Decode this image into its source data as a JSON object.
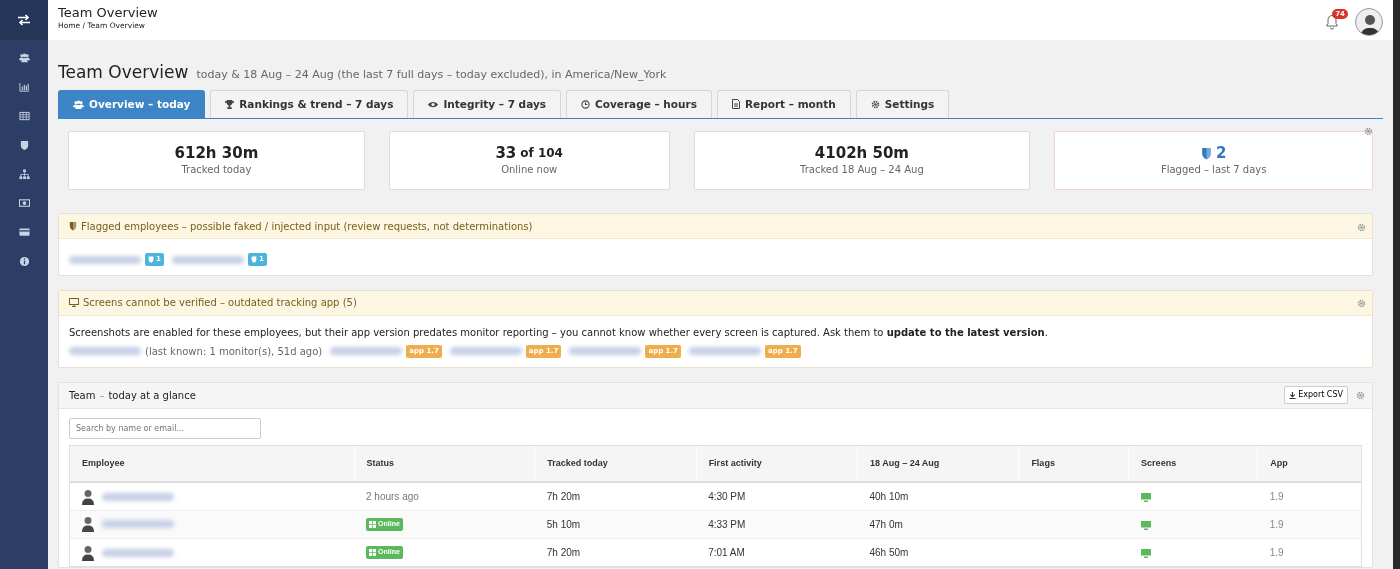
{
  "header": {
    "title": "Team Overview",
    "breadcrumb": "Home / Team Overview",
    "notifications": "74"
  },
  "page": {
    "title": "Team Overview",
    "subtitle": "today & 18 Aug – 24 Aug (the last 7 full days – today excluded), in America/New_York"
  },
  "tabs": [
    {
      "label": "Overview – today",
      "selected": true
    },
    {
      "label": "Rankings & trend – 7 days",
      "selected": false
    },
    {
      "label": "Integrity – 7 days",
      "selected": false
    },
    {
      "label": "Coverage – hours",
      "selected": false
    },
    {
      "label": "Report – month",
      "selected": false
    },
    {
      "label": "Settings",
      "selected": false
    }
  ],
  "stats": [
    {
      "value": "612h 30m",
      "label": "Tracked today",
      "kind": "plain"
    },
    {
      "value": "33",
      "suffix": "of 104",
      "label": "Online now",
      "kind": "plain"
    },
    {
      "value": "4102h 50m",
      "label": "Tracked 18 Aug – 24 Aug",
      "kind": "plain"
    },
    {
      "value": "2",
      "label": "Flagged – last 7 days",
      "kind": "flag"
    }
  ],
  "flagged_panel": {
    "title": "Flagged employees – possible faked / injected input (review requests, not determinations)",
    "employees": [
      {
        "badge": "1"
      },
      {
        "badge": "1"
      }
    ]
  },
  "screens_panel": {
    "title": "Screens cannot be verified – outdated tracking app (5)",
    "message": "Screenshots are enabled for these employees, but their app version predates monitor reporting – you cannot know whether every screen is captured. Ask them to **update to the latest version**.",
    "employees": [
      {
        "kind": "note",
        "text": "(last known: 1 monitor(s), 51d ago)"
      },
      {
        "kind": "badge",
        "text": "app 1.7"
      },
      {
        "kind": "badge",
        "text": "app 1.7"
      },
      {
        "kind": "badge",
        "text": "app 1.7"
      },
      {
        "kind": "badge",
        "text": "app 1.7"
      }
    ]
  },
  "team_panel": {
    "title": "Team",
    "separator": "–",
    "subtitle": "today at a glance",
    "export_button": "Export CSV",
    "search": {
      "placeholder": "Search by name or email..."
    },
    "columns": [
      "Employee",
      "Status",
      "Tracked today",
      "First activity",
      "18 Aug – 24 Aug",
      "Flags",
      "Screens",
      "App"
    ],
    "rows": [
      {
        "status": {
          "kind": "text",
          "text": "2 hours ago"
        },
        "tracked": "7h 20m",
        "first": "4:30 PM",
        "week": "40h 10m",
        "screens": true,
        "app": "1.9"
      },
      {
        "status": {
          "kind": "online",
          "text": "Online"
        },
        "tracked": "5h 10m",
        "first": "4:33 PM",
        "week": "47h 0m",
        "screens": true,
        "app": "1.9"
      },
      {
        "status": {
          "kind": "online",
          "text": "Online"
        },
        "tracked": "7h 20m",
        "first": "7:01 AM",
        "week": "46h 50m",
        "screens": true,
        "app": "1.9"
      }
    ]
  }
}
